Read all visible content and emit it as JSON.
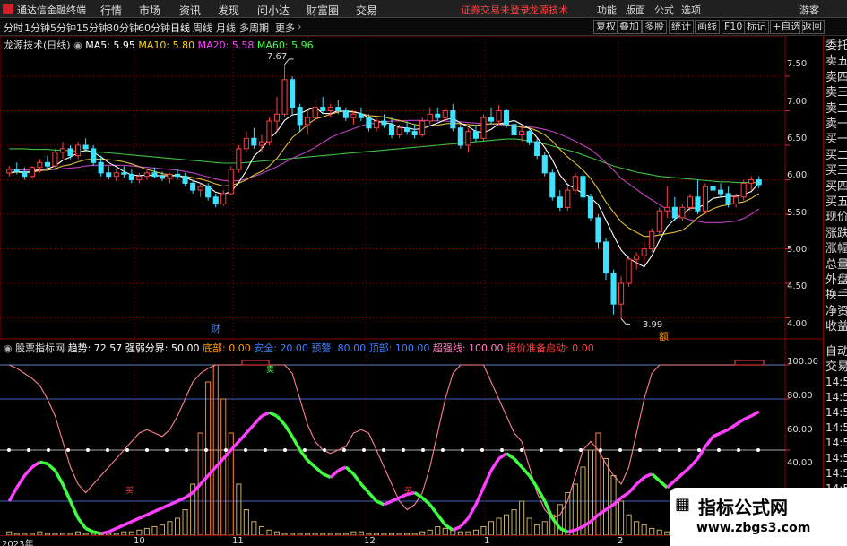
{
  "app": {
    "title": "通达信金融终端",
    "menus": [
      "行情",
      "市场",
      "资讯",
      "发现",
      "问小达",
      "财富圈",
      "交易"
    ],
    "notice_login": "证券交易未登录",
    "notice_stock": "龙源技术",
    "tools": [
      "功能",
      "版面",
      "公式",
      "选项"
    ],
    "guest": "游客"
  },
  "toolbar": {
    "periods": [
      "分时",
      "1分钟",
      "5分钟",
      "15分钟",
      "30分钟",
      "60分钟",
      "日线",
      "周线",
      "月线",
      "多周期",
      "更多"
    ],
    "active_period": "日线",
    "right_buttons": [
      "复权",
      "叠加",
      "多股",
      "统计",
      "画线",
      "F10",
      "标记",
      "+自选",
      "返回"
    ]
  },
  "main_legend": {
    "stock": "龙源技术(日线)",
    "ma5": "MA5: 5.95",
    "ma10": "MA10: 5.80",
    "ma20": "MA20: 5.58",
    "ma60": "MA60: 5.96",
    "colors": {
      "ma5": "#ffffff",
      "ma10": "#ffd700",
      "ma20": "#ff40ff",
      "ma60": "#40ff40"
    }
  },
  "sub_legend": {
    "name": "股票指标网",
    "trend": "趋势: 72.57",
    "strong_weak": "强弱分界: 50.00",
    "bottom": "底部: 0.00",
    "safe": "安全: 20.00",
    "warning": "预警: 80.00",
    "top": "顶部: 100.00",
    "overbought": "超强线: 100.00",
    "ready": "报价准备启动: 0.00",
    "colors": {
      "name": "#ffffff",
      "trend": "#ffffff",
      "strong_weak": "#ffffff",
      "bottom": "#ff9900",
      "safe": "#4080ff",
      "warning": "#4080ff",
      "top": "#4080ff",
      "overbought": "#ff80c0",
      "ready": "#ff4040"
    }
  },
  "sidebar": {
    "items": [
      "委托",
      "卖五",
      "卖四",
      "卖三",
      "卖二",
      "卖一",
      "买一",
      "买二",
      "买三",
      "买四",
      "买五",
      "现价",
      "涨跌",
      "涨幅",
      "总量",
      "外盘",
      "换手",
      "净资",
      "收益"
    ],
    "lower_items": [
      "自动",
      "交易",
      "14:5",
      "14:5",
      "14:5",
      "14:5",
      "14:5",
      "14:5",
      "14:5",
      "14:5",
      "14:5"
    ]
  },
  "main_axis": {
    "ticks": [
      "7.50",
      "7.00",
      "6.50",
      "6.00",
      "5.50",
      "5.00",
      "4.50",
      "4.00"
    ]
  },
  "sub_axis": {
    "ticks": [
      "100.00",
      "80.00",
      "60.00",
      "40.00"
    ]
  },
  "annotations": {
    "high": "7.67",
    "low": "3.99",
    "cai": "财",
    "xiang": "额"
  },
  "sub_markers": {
    "sell": "卖",
    "buy1": "买",
    "buy2": "买"
  },
  "date_axis": {
    "labels": [
      "2023年",
      "10",
      "11",
      "12",
      "1",
      "2"
    ]
  },
  "watermark": {
    "title": "指标公式网",
    "url": "www.zbgs3.com",
    "icon": "chart-icon"
  },
  "chart_data": {
    "type": "candlestick",
    "title": "龙源技术(日线)",
    "ylim": [
      3.8,
      7.85
    ],
    "candles": [
      [
        6.1,
        6.2,
        6.05,
        6.15
      ],
      [
        6.15,
        6.25,
        6.08,
        6.12
      ],
      [
        6.12,
        6.18,
        6.0,
        6.05
      ],
      [
        6.05,
        6.2,
        6.02,
        6.18
      ],
      [
        6.18,
        6.3,
        6.1,
        6.25
      ],
      [
        6.25,
        6.35,
        6.15,
        6.2
      ],
      [
        6.2,
        6.45,
        6.18,
        6.4
      ],
      [
        6.4,
        6.55,
        6.3,
        6.45
      ],
      [
        6.45,
        6.5,
        6.3,
        6.35
      ],
      [
        6.35,
        6.55,
        6.3,
        6.5
      ],
      [
        6.5,
        6.6,
        6.4,
        6.45
      ],
      [
        6.45,
        6.5,
        6.2,
        6.25
      ],
      [
        6.25,
        6.35,
        6.05,
        6.1
      ],
      [
        6.1,
        6.2,
        6.0,
        6.05
      ],
      [
        6.05,
        6.15,
        5.98,
        6.1
      ],
      [
        6.1,
        6.2,
        6.02,
        6.08
      ],
      [
        6.08,
        6.15,
        5.95,
        6.0
      ],
      [
        6.0,
        6.1,
        5.95,
        6.05
      ],
      [
        6.05,
        6.15,
        6.0,
        6.1
      ],
      [
        6.1,
        6.18,
        6.02,
        6.05
      ],
      [
        6.05,
        6.12,
        5.98,
        6.02
      ],
      [
        6.02,
        6.1,
        5.95,
        6.08
      ],
      [
        6.08,
        6.15,
        6.0,
        6.05
      ],
      [
        6.05,
        6.1,
        5.9,
        5.95
      ],
      [
        5.95,
        6.0,
        5.8,
        5.85
      ],
      [
        5.85,
        5.95,
        5.75,
        5.9
      ],
      [
        5.9,
        5.95,
        5.7,
        5.75
      ],
      [
        5.75,
        5.8,
        5.6,
        5.65
      ],
      [
        5.65,
        5.85,
        5.62,
        5.8
      ],
      [
        5.8,
        6.2,
        5.78,
        6.15
      ],
      [
        6.15,
        6.5,
        6.1,
        6.45
      ],
      [
        6.45,
        6.7,
        6.4,
        6.6
      ],
      [
        6.6,
        6.75,
        6.45,
        6.5
      ],
      [
        6.5,
        6.65,
        6.4,
        6.55
      ],
      [
        6.55,
        6.9,
        6.5,
        6.85
      ],
      [
        6.85,
        7.2,
        6.7,
        6.95
      ],
      [
        6.95,
        7.67,
        6.9,
        7.45
      ],
      [
        7.45,
        7.5,
        6.95,
        7.05
      ],
      [
        7.05,
        7.1,
        6.7,
        6.8
      ],
      [
        6.8,
        7.0,
        6.65,
        6.9
      ],
      [
        6.9,
        7.15,
        6.85,
        7.05
      ],
      [
        7.05,
        7.2,
        6.95,
        7.0
      ],
      [
        7.0,
        7.1,
        6.9,
        7.05
      ],
      [
        7.05,
        7.15,
        6.95,
        7.0
      ],
      [
        7.0,
        7.05,
        6.85,
        6.9
      ],
      [
        6.9,
        7.0,
        6.8,
        6.95
      ],
      [
        6.95,
        7.05,
        6.85,
        6.9
      ],
      [
        6.9,
        6.95,
        6.7,
        6.75
      ],
      [
        6.75,
        6.9,
        6.7,
        6.85
      ],
      [
        6.85,
        6.95,
        6.75,
        6.8
      ],
      [
        6.8,
        6.9,
        6.6,
        6.65
      ],
      [
        6.65,
        6.8,
        6.6,
        6.75
      ],
      [
        6.75,
        6.85,
        6.65,
        6.7
      ],
      [
        6.7,
        6.8,
        6.6,
        6.65
      ],
      [
        6.65,
        6.9,
        6.62,
        6.85
      ],
      [
        6.85,
        7.05,
        6.8,
        6.95
      ],
      [
        6.95,
        7.05,
        6.85,
        6.9
      ],
      [
        6.9,
        7.05,
        6.85,
        7.0
      ],
      [
        7.0,
        7.1,
        6.7,
        6.75
      ],
      [
        6.75,
        6.8,
        6.45,
        6.5
      ],
      [
        6.5,
        6.75,
        6.4,
        6.7
      ],
      [
        6.7,
        6.8,
        6.55,
        6.6
      ],
      [
        6.6,
        6.95,
        6.55,
        6.9
      ],
      [
        6.9,
        7.05,
        6.8,
        6.85
      ],
      [
        6.85,
        7.08,
        6.8,
        7.0
      ],
      [
        7.0,
        7.02,
        6.75,
        6.8
      ],
      [
        6.8,
        6.85,
        6.6,
        6.65
      ],
      [
        6.65,
        6.75,
        6.55,
        6.7
      ],
      [
        6.7,
        6.72,
        6.5,
        6.55
      ],
      [
        6.55,
        6.6,
        6.3,
        6.35
      ],
      [
        6.35,
        6.4,
        6.05,
        6.1
      ],
      [
        6.1,
        6.15,
        5.7,
        5.75
      ],
      [
        5.75,
        5.85,
        5.55,
        5.6
      ],
      [
        5.6,
        5.9,
        5.55,
        5.85
      ],
      [
        5.85,
        6.1,
        5.8,
        6.05
      ],
      [
        6.05,
        6.1,
        5.7,
        5.75
      ],
      [
        5.75,
        5.8,
        5.4,
        5.45
      ],
      [
        5.45,
        5.5,
        5.0,
        5.1
      ],
      [
        5.1,
        5.15,
        4.55,
        4.65
      ],
      [
        4.65,
        4.7,
        4.05,
        4.2
      ],
      [
        4.2,
        4.6,
        3.99,
        4.5
      ],
      [
        4.5,
        4.9,
        4.45,
        4.85
      ],
      [
        4.85,
        4.95,
        4.7,
        4.9
      ],
      [
        4.9,
        5.1,
        4.8,
        5.0
      ],
      [
        5.0,
        5.3,
        4.95,
        5.25
      ],
      [
        5.25,
        5.6,
        5.2,
        5.55
      ],
      [
        5.55,
        5.9,
        5.45,
        5.6
      ],
      [
        5.6,
        5.75,
        5.4,
        5.45
      ],
      [
        5.45,
        5.65,
        5.4,
        5.6
      ],
      [
        5.6,
        5.8,
        5.55,
        5.75
      ],
      [
        5.75,
        6.0,
        5.5,
        5.55
      ],
      [
        5.55,
        5.95,
        5.5,
        5.9
      ],
      [
        5.9,
        6.0,
        5.8,
        5.85
      ],
      [
        5.85,
        5.95,
        5.75,
        5.8
      ],
      [
        5.8,
        5.9,
        5.6,
        5.65
      ],
      [
        5.65,
        5.8,
        5.6,
        5.75
      ],
      [
        5.75,
        6.0,
        5.7,
        5.95
      ],
      [
        5.95,
        6.05,
        5.85,
        6.0
      ],
      [
        6.0,
        6.05,
        5.88,
        5.93
      ]
    ],
    "ma5": [
      6.1,
      6.12,
      6.11,
      6.12,
      6.15,
      6.16,
      6.2,
      6.28,
      6.33,
      6.39,
      6.43,
      6.4,
      6.33,
      6.25,
      6.19,
      6.12,
      6.07,
      6.06,
      6.07,
      6.06,
      6.06,
      6.06,
      6.06,
      6.03,
      5.99,
      5.95,
      5.9,
      5.82,
      5.79,
      5.83,
      5.96,
      6.13,
      6.34,
      6.45,
      6.59,
      6.7,
      6.86,
      6.94,
      6.96,
      7.01,
      7.05,
      6.96,
      6.96,
      7.0,
      6.99,
      6.98,
      6.96,
      6.9,
      6.85,
      6.83,
      6.81,
      6.76,
      6.75,
      6.73,
      6.74,
      6.78,
      6.82,
      6.87,
      6.89,
      6.82,
      6.77,
      6.7,
      6.68,
      6.73,
      6.81,
      6.83,
      6.86,
      6.8,
      6.74,
      6.61,
      6.47,
      6.29,
      6.07,
      5.93,
      5.87,
      5.8,
      5.74,
      5.64,
      5.42,
      5.19,
      4.98,
      4.86,
      4.8,
      4.74,
      4.9,
      5.12,
      5.32,
      5.43,
      5.49,
      5.59,
      5.59,
      5.65,
      5.73,
      5.75,
      5.76,
      5.76,
      5.79,
      5.83,
      5.95
    ],
    "ma10": [
      6.1,
      6.11,
      6.1,
      6.11,
      6.13,
      6.14,
      6.16,
      6.2,
      6.22,
      6.26,
      6.29,
      6.3,
      6.3,
      6.29,
      6.28,
      6.26,
      6.23,
      6.19,
      6.15,
      6.12,
      6.09,
      6.07,
      6.06,
      6.05,
      6.03,
      6.01,
      5.98,
      5.94,
      5.91,
      5.92,
      5.95,
      6.0,
      6.07,
      6.12,
      6.2,
      6.31,
      6.46,
      6.61,
      6.7,
      6.8,
      6.88,
      6.91,
      6.95,
      6.98,
      7.0,
      6.99,
      6.96,
      6.93,
      6.92,
      6.91,
      6.88,
      6.86,
      6.83,
      6.8,
      6.78,
      6.78,
      6.79,
      6.81,
      6.82,
      6.81,
      6.8,
      6.79,
      6.8,
      6.81,
      6.81,
      6.8,
      6.78,
      6.76,
      6.75,
      6.71,
      6.65,
      6.56,
      6.44,
      6.33,
      6.24,
      6.14,
      6.02,
      5.86,
      5.68,
      5.53,
      5.39,
      5.3,
      5.24,
      5.18,
      5.18,
      5.2,
      5.22,
      5.24,
      5.27,
      5.35,
      5.45,
      5.52,
      5.58,
      5.62,
      5.64,
      5.66,
      5.68,
      5.73,
      5.8
    ],
    "ma20": [
      6.15,
      6.15,
      6.14,
      6.14,
      6.14,
      6.14,
      6.15,
      6.16,
      6.17,
      6.18,
      6.2,
      6.21,
      6.21,
      6.21,
      6.21,
      6.21,
      6.2,
      6.19,
      6.18,
      6.17,
      6.16,
      6.15,
      6.14,
      6.12,
      6.1,
      6.07,
      6.04,
      6.01,
      5.99,
      5.98,
      5.99,
      6.01,
      6.05,
      6.09,
      6.14,
      6.19,
      6.25,
      6.31,
      6.36,
      6.41,
      6.47,
      6.54,
      6.61,
      6.66,
      6.7,
      6.74,
      6.78,
      6.81,
      6.82,
      6.84,
      6.85,
      6.85,
      6.86,
      6.86,
      6.86,
      6.86,
      6.85,
      6.85,
      6.84,
      6.84,
      6.83,
      6.82,
      6.81,
      6.81,
      6.8,
      6.79,
      6.78,
      6.77,
      6.77,
      6.75,
      6.73,
      6.7,
      6.66,
      6.61,
      6.56,
      6.5,
      6.44,
      6.35,
      6.25,
      6.14,
      6.02,
      5.94,
      5.86,
      5.78,
      5.71,
      5.64,
      5.57,
      5.51,
      5.46,
      5.42,
      5.4,
      5.38,
      5.38,
      5.38,
      5.39,
      5.4,
      5.44,
      5.5,
      5.58
    ],
    "ma60": [
      6.45,
      6.45,
      6.45,
      6.44,
      6.44,
      6.44,
      6.43,
      6.43,
      6.42,
      6.42,
      6.41,
      6.4,
      6.4,
      6.39,
      6.38,
      6.37,
      6.36,
      6.35,
      6.34,
      6.33,
      6.32,
      6.31,
      6.3,
      6.29,
      6.28,
      6.27,
      6.26,
      6.25,
      6.24,
      6.24,
      6.24,
      6.25,
      6.26,
      6.27,
      6.28,
      6.29,
      6.3,
      6.31,
      6.32,
      6.33,
      6.34,
      6.35,
      6.36,
      6.37,
      6.38,
      6.39,
      6.4,
      6.41,
      6.42,
      6.43,
      6.44,
      6.45,
      6.46,
      6.47,
      6.48,
      6.49,
      6.5,
      6.51,
      6.52,
      6.53,
      6.54,
      6.55,
      6.56,
      6.57,
      6.58,
      6.59,
      6.59,
      6.58,
      6.56,
      6.54,
      6.52,
      6.49,
      6.46,
      6.43,
      6.4,
      6.36,
      6.32,
      6.28,
      6.24,
      6.2,
      6.17,
      6.14,
      6.11,
      6.09,
      6.07,
      6.05,
      6.04,
      6.03,
      6.02,
      6.01,
      6.0,
      5.99,
      5.98,
      5.97,
      5.97,
      5.96,
      5.96,
      5.96,
      5.96
    ],
    "indicator": {
      "ylim": [
        0,
        110
      ],
      "safe_level": 20,
      "mid_level": 50,
      "warn_level": 80,
      "top_level": 100,
      "pink_line": [
        100,
        98,
        95,
        92,
        88,
        80,
        70,
        55,
        40,
        30,
        25,
        30,
        35,
        40,
        45,
        50,
        55,
        60,
        62,
        60,
        58,
        62,
        70,
        80,
        90,
        95,
        98,
        100,
        100,
        100,
        100,
        100,
        100,
        100,
        100,
        100,
        100,
        95,
        80,
        65,
        55,
        50,
        48,
        50,
        52,
        60,
        62,
        60,
        50,
        40,
        30,
        20,
        15,
        18,
        25,
        40,
        60,
        80,
        95,
        100,
        100,
        100,
        100,
        90,
        80,
        70,
        60,
        55,
        40,
        25,
        15,
        10,
        12,
        20,
        35,
        50,
        55,
        50,
        42,
        35,
        30,
        40,
        60,
        80,
        95,
        100,
        100,
        100,
        100,
        100,
        100,
        100,
        100,
        100,
        100,
        100,
        100,
        100,
        100
      ],
      "trend_line": [
        20,
        28,
        35,
        40,
        43,
        42,
        38,
        30,
        20,
        10,
        4,
        2,
        1,
        2,
        4,
        6,
        8,
        10,
        12,
        14,
        16,
        18,
        20,
        22,
        25,
        30,
        35,
        40,
        45,
        50,
        55,
        60,
        65,
        70,
        72,
        70,
        65,
        58,
        50,
        44,
        40,
        36,
        34,
        38,
        40,
        36,
        30,
        25,
        20,
        18,
        20,
        22,
        24,
        25,
        22,
        18,
        12,
        6,
        3,
        5,
        10,
        18,
        28,
        38,
        45,
        48,
        45,
        40,
        35,
        28,
        20,
        10,
        4,
        2,
        3,
        5,
        8,
        12,
        15,
        18,
        22,
        25,
        30,
        34,
        36,
        32,
        28,
        32,
        36,
        40,
        45,
        52,
        58,
        60,
        62,
        65,
        68,
        70,
        72.57
      ],
      "volume": [
        2,
        1,
        1,
        1,
        2,
        1,
        1,
        1,
        1,
        2,
        1,
        1,
        1,
        1,
        1,
        2,
        2,
        3,
        4,
        5,
        6,
        8,
        10,
        15,
        30,
        60,
        90,
        100,
        80,
        60,
        30,
        15,
        8,
        5,
        3,
        2,
        1,
        1,
        1,
        1,
        1,
        1,
        1,
        1,
        1,
        2,
        2,
        1,
        1,
        1,
        1,
        1,
        1,
        1,
        2,
        3,
        5,
        4,
        3,
        2,
        2,
        3,
        5,
        8,
        10,
        12,
        15,
        20,
        10,
        6,
        8,
        12,
        18,
        25,
        30,
        40,
        50,
        60,
        45,
        35,
        20,
        12,
        8,
        6,
        4,
        3,
        2,
        2,
        1,
        1,
        1,
        1,
        1,
        1,
        1,
        1,
        1,
        1,
        1
      ]
    }
  }
}
